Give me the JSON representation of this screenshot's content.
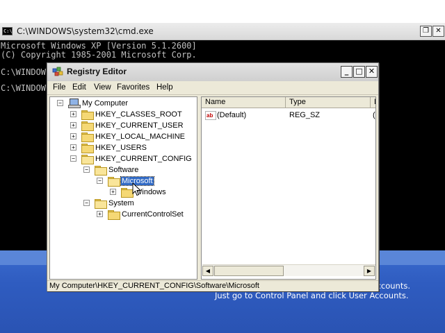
{
  "cmd": {
    "title": "C:\\WINDOWS\\system32\\cmd.exe",
    "icon_text": "C:\\",
    "lines": [
      "Microsoft Windows XP [Version 5.1.2600]",
      "(C) Copyright 1985-2001 Microsoft Corp."
    ],
    "prompt1": "C:\\WINDOW",
    "prompt2": "C:\\WINDOW",
    "restore_glyph": "❐",
    "close_glyph": "✕"
  },
  "regedit": {
    "title": "Registry Editor",
    "min_glyph": "_",
    "max_glyph": "□",
    "close_glyph": "✕",
    "menu": [
      "File",
      "Edit",
      "View",
      "Favorites",
      "Help"
    ],
    "tree": {
      "root": "My Computer",
      "root_expander": "−",
      "hkcr": "HKEY_CLASSES_ROOT",
      "hkcu": "HKEY_CURRENT_USER",
      "hklm": "HKEY_LOCAL_MACHINE",
      "hku": "HKEY_USERS",
      "hkcc": "HKEY_CURRENT_CONFIG",
      "software": "Software",
      "microsoft": "Microsoft",
      "windows": "Windows",
      "system": "System",
      "currentcontrolset": "CurrentControlSet",
      "plus": "+",
      "minus": "−"
    },
    "columns": [
      "Name",
      "Type",
      "D"
    ],
    "values": [
      {
        "icon_text": "ab",
        "name": "(Default)",
        "type": "REG_SZ",
        "data": "("
      }
    ],
    "scroll_left": "◀",
    "scroll_right": "▶",
    "status": "My Computer\\HKEY_CURRENT_CONFIG\\Software\\Microsoft"
  },
  "desktop": {
    "message_line1": "ccounts.",
    "message_line2": "Just go to Control Panel and click User Accounts."
  },
  "colors": {
    "selection": "#316ac5",
    "desktop_blue": "#2f5cc0",
    "console_bg": "#000000"
  }
}
